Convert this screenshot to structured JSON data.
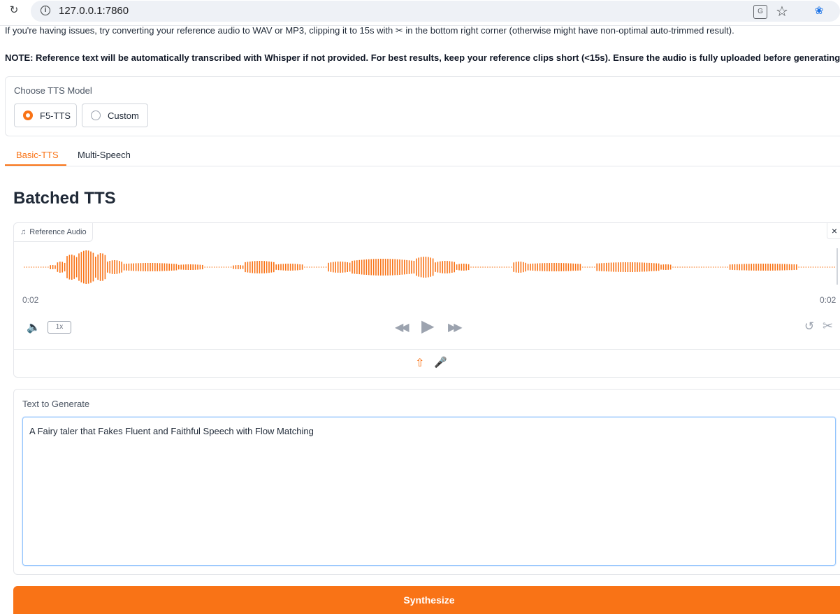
{
  "browser": {
    "url": "127.0.0.1:7860",
    "reload_icon": "reload-icon",
    "info_icon": "info-icon",
    "translate_icon": "translate-icon",
    "star_icon": "star-icon",
    "extension_icon": "extension-icon"
  },
  "notice": "If you're having issues, try converting your reference audio to WAV or MP3, clipping it to 15s with ✂ in the bottom right corner (otherwise might have non-optimal auto-trimmed result).",
  "note": "NOTE: Reference text will be automatically transcribed with Whisper if not provided. For best results, keep your reference clips short (<15s). Ensure the audio is fully uploaded before generating.",
  "model": {
    "label": "Choose TTS Model",
    "options": [
      "F5-TTS",
      "Custom"
    ],
    "selected": "F5-TTS"
  },
  "tabs": [
    "Basic-TTS",
    "Multi-Speech"
  ],
  "active_tab": "Basic-TTS",
  "heading": "Batched TTS",
  "audio": {
    "label": "Reference Audio",
    "time_start": "0:02",
    "time_end": "0:02",
    "speed": "1x",
    "close_label": "×"
  },
  "text_input": {
    "label": "Text to Generate",
    "value": "A Fairy taler that Fakes Fluent and Faithful Speech with Flow Matching"
  },
  "synthesize_label": "Synthesize",
  "colors": {
    "accent": "#f97316",
    "border": "#e5e7eb",
    "muted": "#9ca3af"
  }
}
